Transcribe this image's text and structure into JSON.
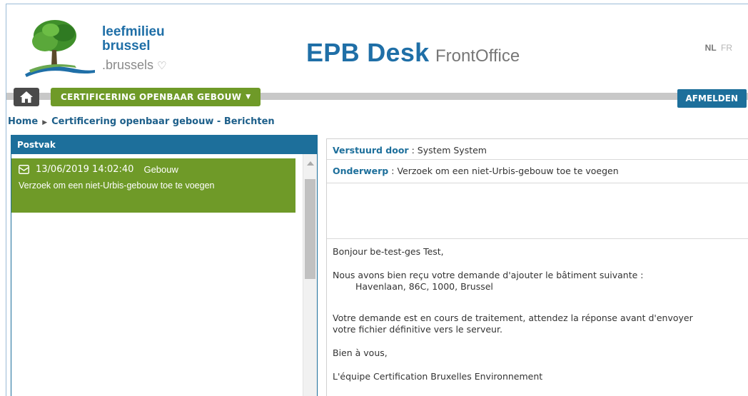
{
  "header": {
    "logo_line1": "leefmilieu",
    "logo_line2": "brussel",
    "logo_line3": ".brussels",
    "app_title_main": "EPB Desk",
    "app_title_sub": "FrontOffice",
    "lang_active": "NL",
    "lang_other": "FR"
  },
  "nav": {
    "menu_label": "CERTIFICERING OPENBAAR GEBOUW",
    "logout_label": "AFMELDEN",
    "colors": {
      "green": "#6f9a28",
      "blue": "#1d6f9b",
      "dark": "#4a4a4a"
    }
  },
  "breadcrumb": {
    "home": "Home",
    "current": "Certificering openbaar gebouw - Berichten"
  },
  "inbox": {
    "title": "Postvak",
    "messages": [
      {
        "datetime": "13/06/2019 14:02:40",
        "category": "Gebouw",
        "subject": "Verzoek om een niet-Urbis-gebouw toe te voegen"
      }
    ]
  },
  "detail": {
    "sender_label": "Verstuurd door",
    "sender_value": "System System",
    "subject_label": "Onderwerp",
    "subject_value": "Verzoek om een niet-Urbis-gebouw toe te voegen",
    "body": {
      "greeting": "Bonjour be-test-ges Test,",
      "para1": "Nous avons bien reçu votre demande d'ajouter le bâtiment suivante :",
      "address": "Havenlaan, 86C, 1000, Brussel",
      "para2_line1": "Votre demande est en cours de traitement, attendez la réponse avant d'envoyer",
      "para2_line2": "votre fichier définitive vers le serveur.",
      "closing": "Bien à vous,",
      "signature": "L'équipe Certification Bruxelles Environnement"
    }
  }
}
